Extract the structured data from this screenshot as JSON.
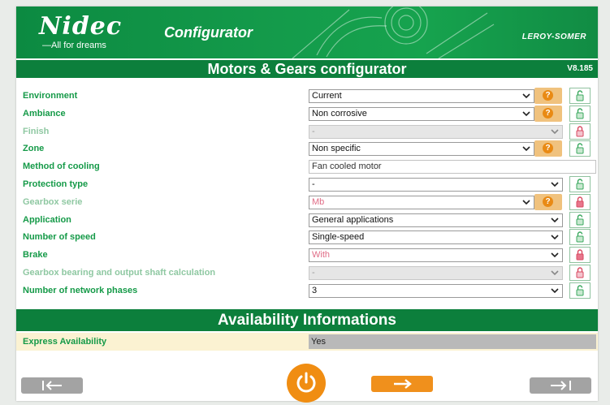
{
  "header": {
    "brand_name": "Nidec",
    "brand_tagline": "—All for dreams",
    "app_title": "Configurator",
    "partner_logo": "LEROY-SOMER"
  },
  "title_bar": {
    "title": "Motors & Gears configurator",
    "version": "V8.185"
  },
  "rows": [
    {
      "label": "Environment",
      "value": "Current"
    },
    {
      "label": "Ambiance",
      "value": "Non corrosive"
    },
    {
      "label": "Finish",
      "value": "-"
    },
    {
      "label": "Zone",
      "value": "Non specific"
    },
    {
      "label": "Method of cooling",
      "value": "Fan cooled motor"
    },
    {
      "label": "Protection type",
      "value": "-"
    },
    {
      "label": "Gearbox serie",
      "value": "Mb"
    },
    {
      "label": "Application",
      "value": "General applications"
    },
    {
      "label": "Number of speed",
      "value": "Single-speed"
    },
    {
      "label": "Brake",
      "value": "With"
    },
    {
      "label": "Gearbox bearing and output shaft calculation",
      "value": "-"
    },
    {
      "label": "Number of network phases",
      "value": "3"
    }
  ],
  "availability": {
    "title": "Availability Informations",
    "label": "Express Availability",
    "value": "Yes"
  },
  "icons": {
    "help": "help-icon",
    "lock_open": "unlocked-icon",
    "lock_closed": "locked-icon",
    "power": "power-icon",
    "first": "first-page-icon",
    "next": "next-arrow-icon",
    "last": "last-page-icon"
  },
  "colors": {
    "brand_green": "#0c7f3c",
    "label_green": "#159a48",
    "accent_orange": "#f0901c",
    "lock_red": "#d94a61",
    "availability_bg": "#fbf2d2"
  }
}
